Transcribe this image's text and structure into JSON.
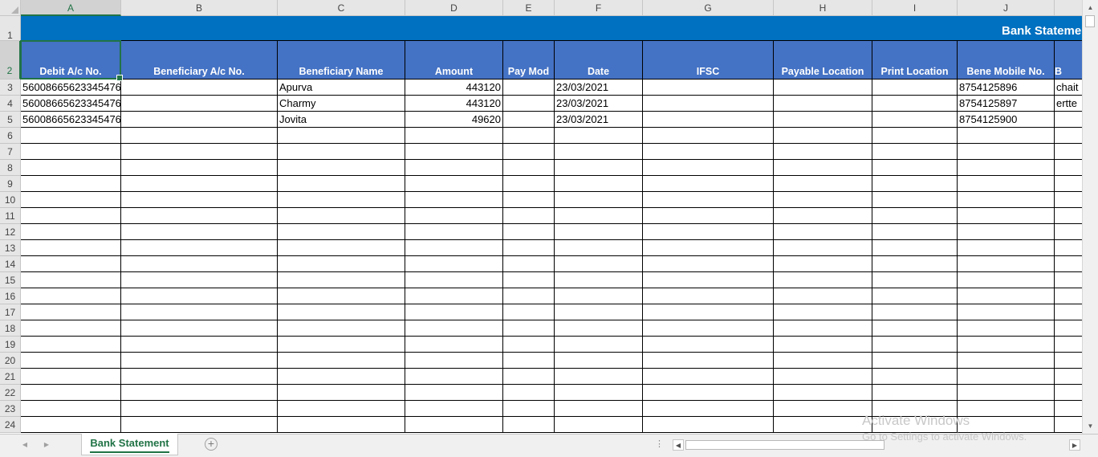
{
  "window": {
    "sheet_tab": "Bank Statement",
    "add_sheet": "⊕"
  },
  "title": "Bank Statement",
  "columns": [
    "A",
    "B",
    "C",
    "D",
    "E",
    "F",
    "G",
    "H",
    "I",
    "J"
  ],
  "selected_column": "A",
  "headers": [
    "Debit A/c No.",
    "Beneficiary A/c No.",
    "Beneficiary Name",
    "Amount",
    "Pay Mod",
    "Date",
    "IFSC",
    "Payable Location",
    "Print Location",
    "Bene Mobile No.",
    "B"
  ],
  "rows": [
    {
      "debit": "56008665623345476",
      "beneficiary_ac": "",
      "name": "Apurva",
      "amount": "443120",
      "pay_mod": "",
      "date": "23/03/2021",
      "ifsc": "",
      "payable": "",
      "print": "",
      "mobile": "8754125896",
      "extra": "chait"
    },
    {
      "debit": "56008665623345476",
      "beneficiary_ac": "",
      "name": "Charmy",
      "amount": "443120",
      "pay_mod": "",
      "date": "23/03/2021",
      "ifsc": "",
      "payable": "",
      "print": "",
      "mobile": "8754125897",
      "extra": "ertte"
    },
    {
      "debit": "56008665623345476",
      "beneficiary_ac": "",
      "name": "Jovita",
      "amount": "49620",
      "pay_mod": "",
      "date": "23/03/2021",
      "ifsc": "",
      "payable": "",
      "print": "",
      "mobile": "8754125900",
      "extra": ""
    }
  ],
  "row_numbers": [
    "1",
    "2",
    "3",
    "4",
    "5",
    "6",
    "7",
    "8",
    "9",
    "10",
    "11",
    "12",
    "13",
    "14",
    "15",
    "16",
    "17",
    "18",
    "19",
    "20",
    "21",
    "22",
    "23",
    "24"
  ],
  "selected_row": "2",
  "watermark": {
    "line1": "Activate Windows",
    "line2": "Go to Settings to activate Windows."
  },
  "colors": {
    "title_band": "#0070c0",
    "header_fill": "#4472c4",
    "accent": "#217346"
  }
}
